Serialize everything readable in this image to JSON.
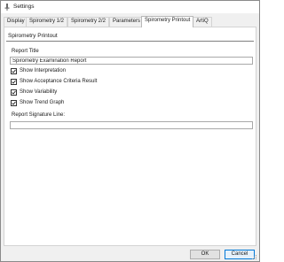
{
  "window": {
    "title": "Settings",
    "title_icon": "settings-icon"
  },
  "tabs": [
    {
      "label": "Display",
      "active": false
    },
    {
      "label": "Spirometry 1/2",
      "active": false
    },
    {
      "label": "Spirometry 2/2",
      "active": false
    },
    {
      "label": "Parameters",
      "active": false
    },
    {
      "label": "Spirometry Printout",
      "active": true
    },
    {
      "label": "ArtiQ",
      "active": false
    }
  ],
  "panel": {
    "section_title": "Spirometry Printout",
    "report_title_label": "Report Title",
    "report_title_value": "Spirometry Examination Report",
    "checkboxes": [
      {
        "label": "Show Interpretation",
        "checked": true
      },
      {
        "label": "Show Acceptance Criteria Result",
        "checked": true
      },
      {
        "label": "Show Variability",
        "checked": true
      },
      {
        "label": "Show Trend Graph",
        "checked": true
      }
    ],
    "signature_label": "Report Signature Line:",
    "signature_value": ""
  },
  "buttons": {
    "ok_label": "OK",
    "cancel_label": "Cancel"
  },
  "colors": {
    "accent": "#0078d7",
    "window_bg": "#f0f0f0",
    "panel_bg": "#ffffff"
  }
}
